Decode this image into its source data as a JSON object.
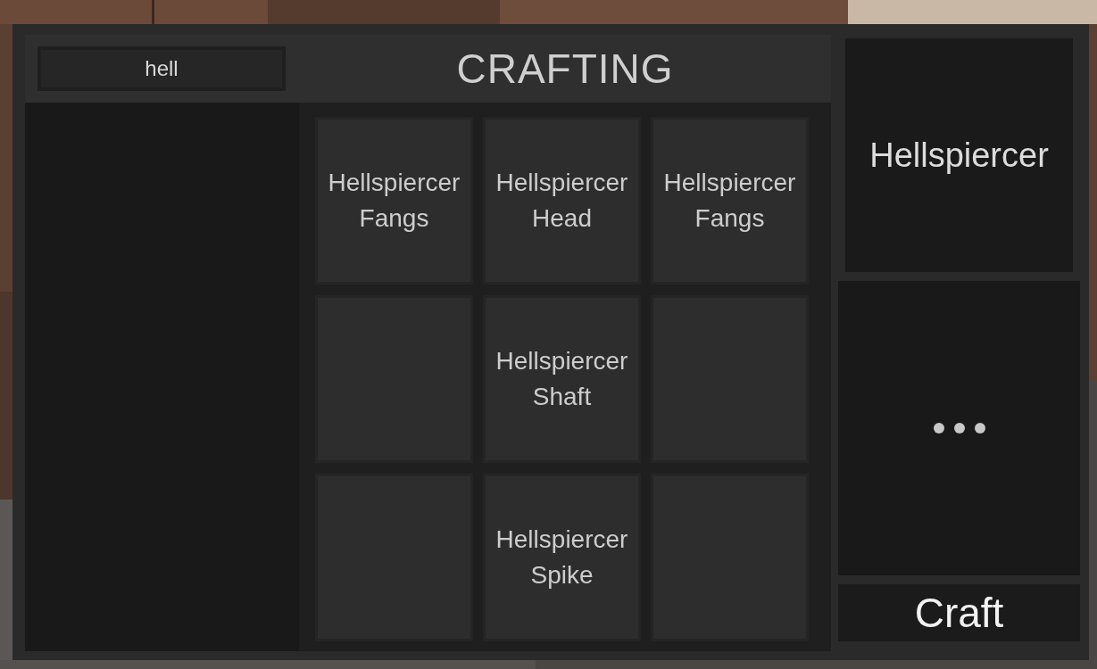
{
  "search": {
    "value": "hell"
  },
  "title": "CRAFTING",
  "slots": [
    {
      "kind": "item",
      "label": "Hellspiercer Fangs"
    },
    {
      "kind": "item",
      "label": "Hellspiercer Head"
    },
    {
      "kind": "item",
      "label": "Hellspiercer Fangs"
    },
    {
      "kind": "empty"
    },
    {
      "kind": "item",
      "label": "Hellspiercer Shaft"
    },
    {
      "kind": "empty"
    },
    {
      "kind": "empty"
    },
    {
      "kind": "item",
      "label": "Hellspiercer Spike"
    },
    {
      "kind": "empty"
    }
  ],
  "result": {
    "name": "Hellspiercer"
  },
  "craft_button": "Craft"
}
